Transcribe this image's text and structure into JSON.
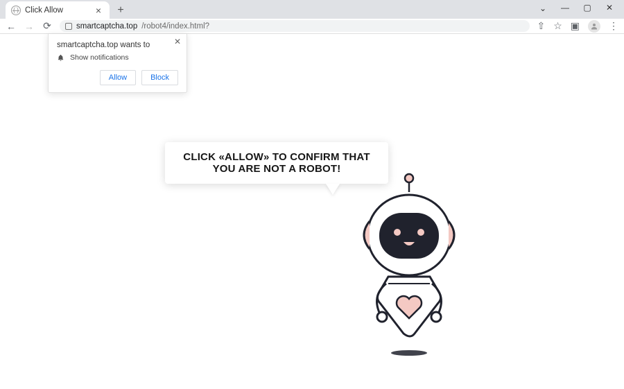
{
  "window": {
    "tab_title": "Click Allow",
    "controls": {
      "chevron": "⌄",
      "minimize": "—",
      "maximize": "▢",
      "close": "✕"
    }
  },
  "toolbar": {
    "back": "←",
    "forward": "→",
    "reload": "⟳",
    "url_host": "smartcaptcha.top",
    "url_path": "/robot4/index.html?",
    "share": "⇧",
    "star": "☆",
    "ext": "▣",
    "menu": "⋮"
  },
  "perm": {
    "origin_wants_to": "smartcaptcha.top wants to",
    "capability": "Show notifications",
    "allow": "Allow",
    "block": "Block",
    "close": "✕"
  },
  "bubble": {
    "text": "CLICK «ALLOW» TO CONFIRM THAT YOU ARE NOT A ROBOT!"
  },
  "colors": {
    "accent": "#1a73e8",
    "robot_pink": "#f4c9c3",
    "robot_face": "#20222d"
  }
}
